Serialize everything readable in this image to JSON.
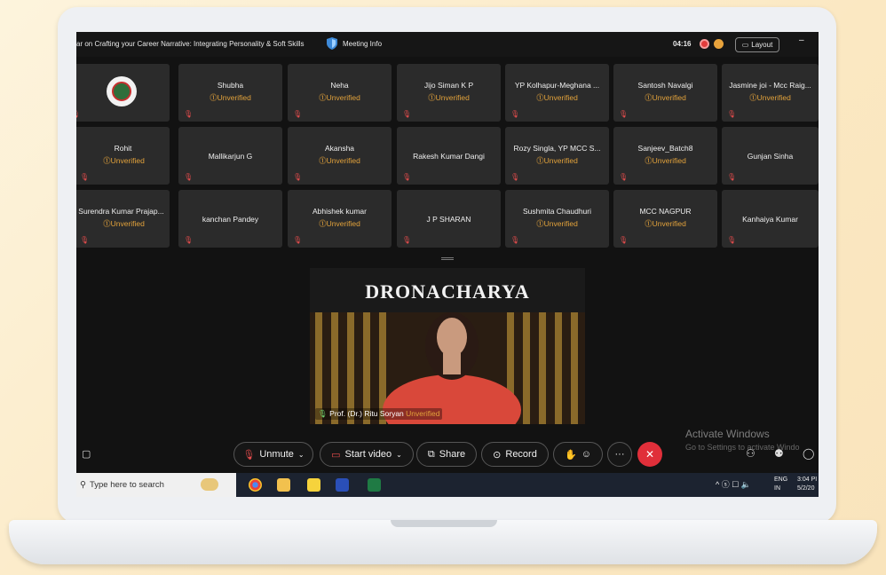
{
  "meeting": {
    "title": "ar on Crafting your Career Narrative: Integrating Personality & Soft Skills",
    "info_label": "Meeting Info",
    "timer": "04:16",
    "layout_label": "Layout",
    "minimize": "–"
  },
  "participants": [
    {
      "name": "",
      "status": "",
      "avatar": true
    },
    {
      "name": "Shubha",
      "status": "⓵Unverified"
    },
    {
      "name": "Neha",
      "status": "⓵Unverified"
    },
    {
      "name": "Jijo Siman K P",
      "status": "⓵Unverified"
    },
    {
      "name": "YP Kolhapur-Meghana ...",
      "status": "⓵Unverified"
    },
    {
      "name": "Santosh Navalgi",
      "status": "⓵Unverified"
    },
    {
      "name": "Jasmine joi - Mcc Raig...",
      "status": "⓵Unverified"
    },
    {
      "name": "Rohit",
      "status": "⓵Unverified"
    },
    {
      "name": "Mallikarjun G",
      "status": ""
    },
    {
      "name": "Akansha",
      "status": "⓵Unverified"
    },
    {
      "name": "Rakesh Kumar Dangi",
      "status": ""
    },
    {
      "name": "Rozy Singla, YP MCC S...",
      "status": "⓵Unverified"
    },
    {
      "name": "Sanjeev_Batch8",
      "status": "⓵Unverified"
    },
    {
      "name": "Gunjan Sinha",
      "status": ""
    },
    {
      "name": "Surendra Kumar Prajap...",
      "status": "⓵Unverified"
    },
    {
      "name": "kanchan Pandey",
      "status": ""
    },
    {
      "name": "Abhishek kumar",
      "status": "⓵Unverified"
    },
    {
      "name": "J P SHARAN",
      "status": ""
    },
    {
      "name": "Sushmita Chaudhuri",
      "status": "⓵Unverified"
    },
    {
      "name": "MCC NAGPUR",
      "status": "⓵Unverified"
    },
    {
      "name": "Kanhaiya Kumar",
      "status": ""
    }
  ],
  "video": {
    "banner": "DRONACHARYA",
    "speaker": "Prof. (Dr.) Ritu Soryan",
    "speaker_status": "Unverified"
  },
  "controls": {
    "unmute": "Unmute",
    "start_video": "Start video",
    "share": "Share",
    "record": "Record",
    "more": "···"
  },
  "watermark": {
    "title": "Activate Windows",
    "subtitle": "Go to Settings to activate Windo"
  },
  "taskbar": {
    "search_placeholder": "Type here to search",
    "lang_top": "ENG",
    "lang_bottom": "IN",
    "time": "3:04 PI",
    "date": "5/2/20"
  },
  "colors": {
    "unverified": "#e2a23b",
    "end_button": "#e02f3a",
    "tile_bg": "#2b2b2b"
  }
}
